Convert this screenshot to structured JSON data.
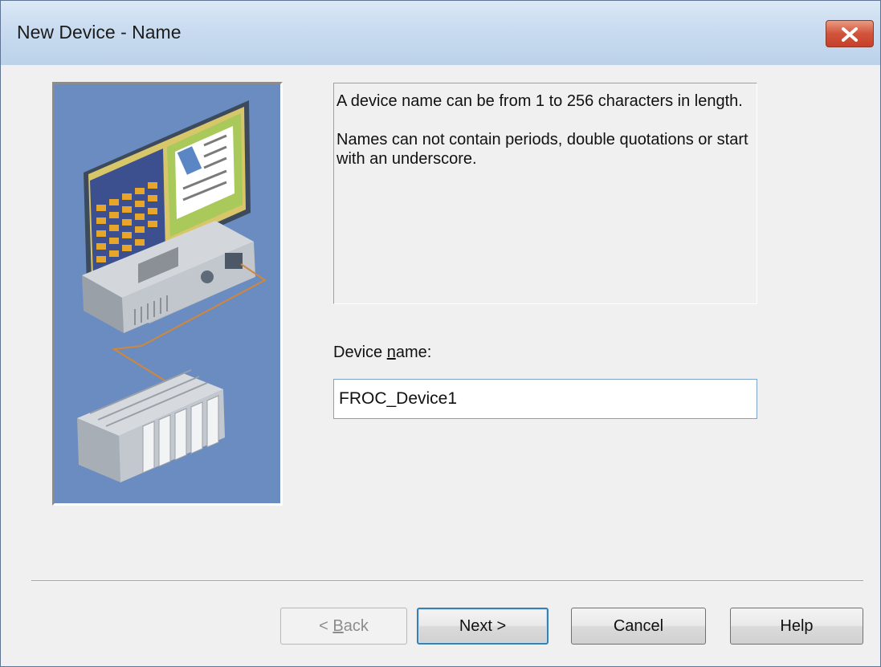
{
  "window": {
    "title": "New Device - Name",
    "close_icon": "close-icon",
    "close_color": "#c7402a"
  },
  "illustration": {
    "description_icon": "computer-and-plc-illustration",
    "background_color": "#6a8cc0"
  },
  "info": {
    "line1": "A device name can be from 1 to 256 characters in length.",
    "line2": "Names can not contain periods, double quotations or start with an underscore."
  },
  "field": {
    "label_pre": "Device ",
    "label_underlined": "n",
    "label_post": "ame:",
    "value": "FROC_Device1"
  },
  "buttons": {
    "back_pre": "< ",
    "back_underlined": "B",
    "back_post": "ack",
    "next": "Next >",
    "cancel": "Cancel",
    "help": "Help"
  }
}
